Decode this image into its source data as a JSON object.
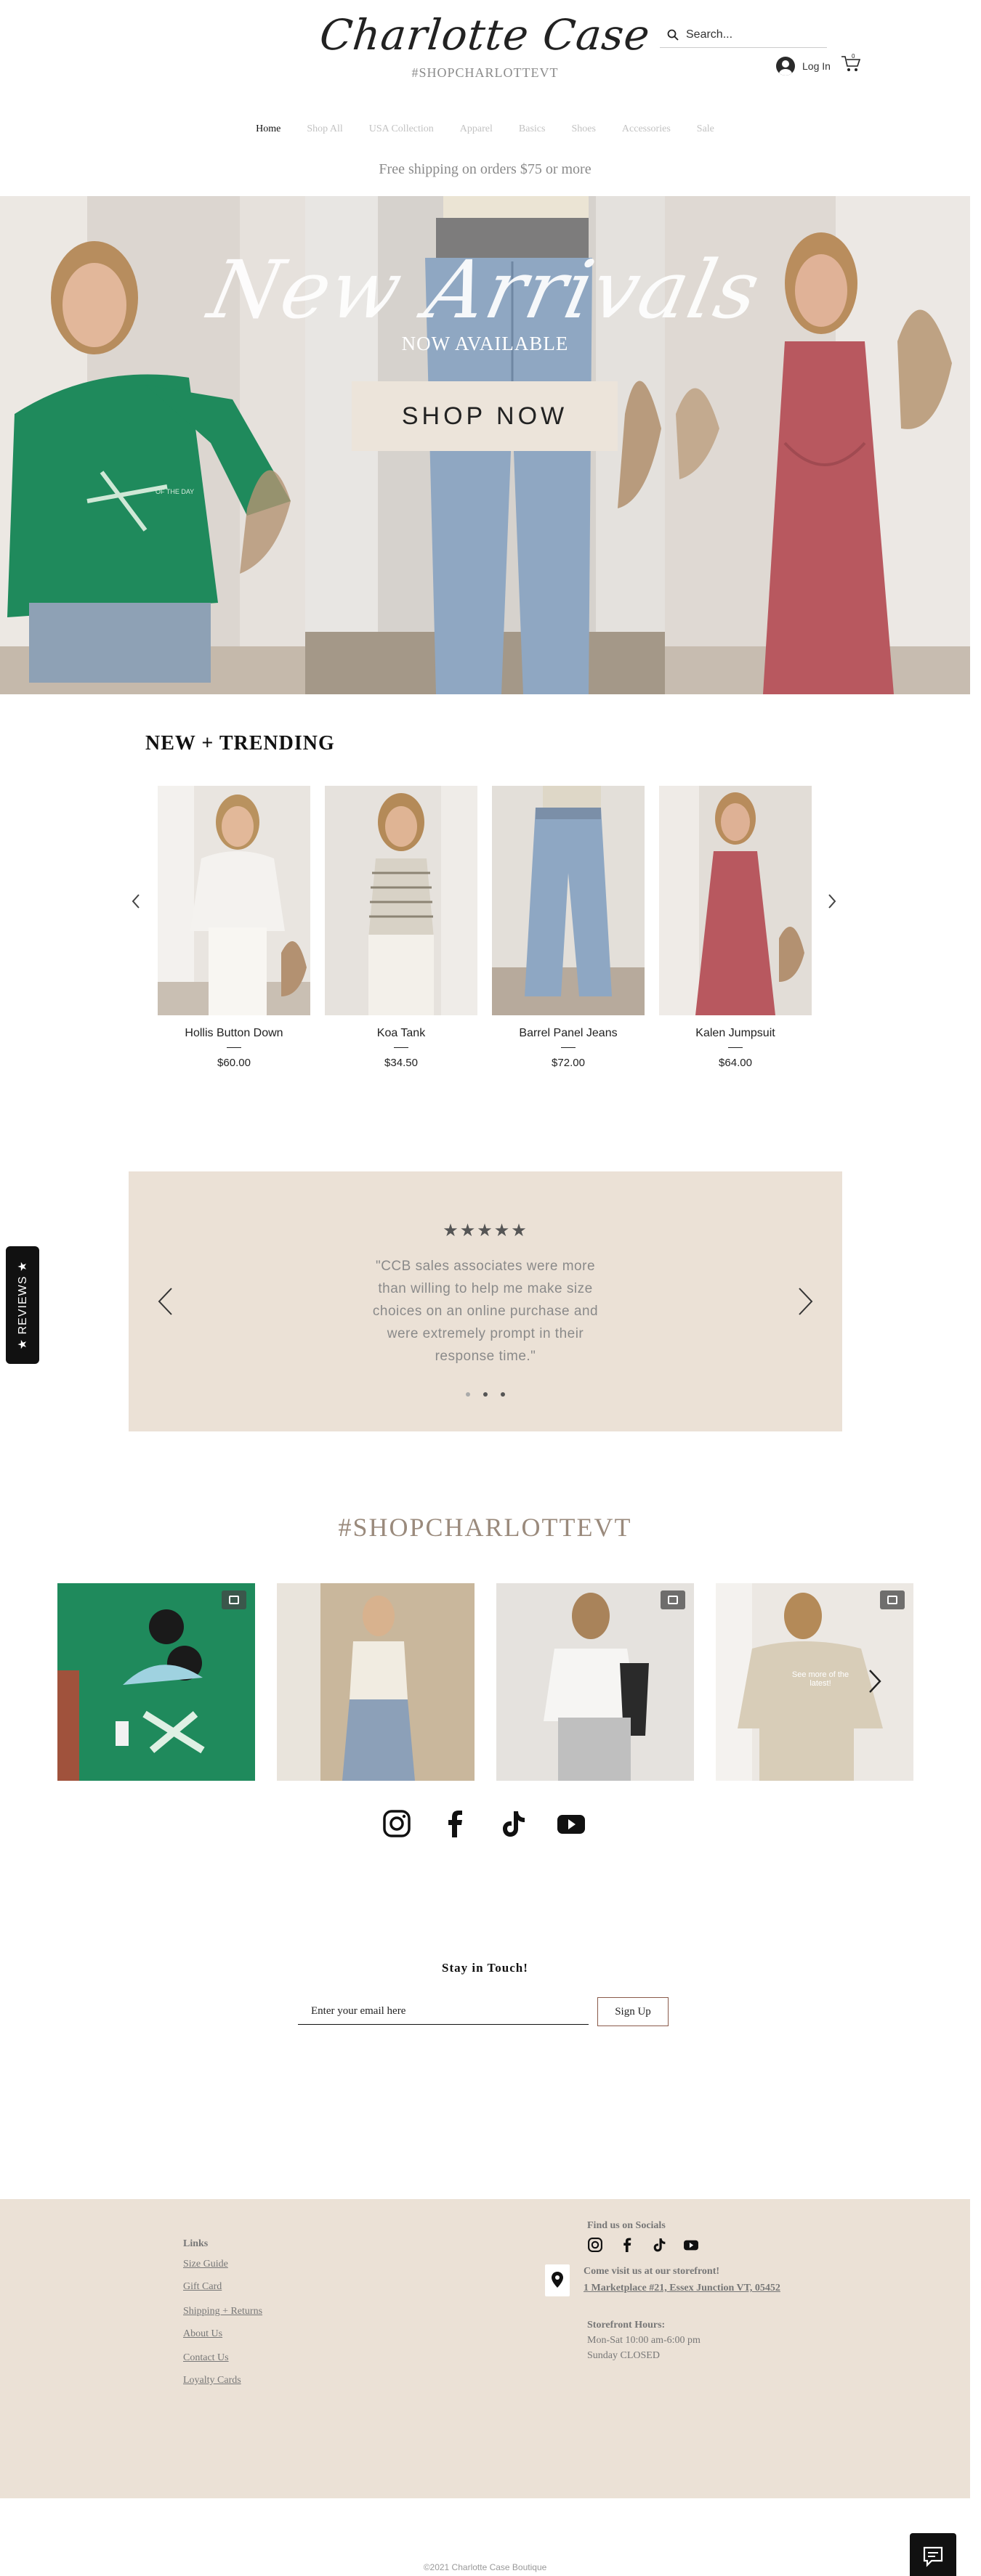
{
  "header": {
    "logo": "Charlotte Case",
    "tagline": "#SHOPCHARLOTTEVT",
    "search_placeholder": "Search...",
    "login_label": "Log In"
  },
  "nav": {
    "items": [
      "Home",
      "Shop All",
      "USA Collection",
      "Apparel",
      "Basics",
      "Shoes",
      "Accessories",
      "Sale"
    ]
  },
  "shipping_banner": "Free shipping on orders $75 or more",
  "hero": {
    "title": "New Arrivals",
    "subtitle": "NOW AVAILABLE",
    "button": "SHOP NOW",
    "shirt_text": "OF THE DAY"
  },
  "trending": {
    "title": "NEW + TRENDING",
    "products": [
      {
        "name": "Hollis Button Down",
        "price": "$60.00"
      },
      {
        "name": "Koa Tank",
        "price": "$34.50"
      },
      {
        "name": "Barrel Panel Jeans",
        "price": "$72.00"
      },
      {
        "name": "Kalen Jumpsuit",
        "price": "$64.00"
      }
    ]
  },
  "reviews": {
    "stars": "★★★★★",
    "quote": "\"CCB sales associates were more than willing to help me make size choices on an online purchase and were extremely prompt in their response time.\"",
    "slide_count": 3,
    "active_slide": 2,
    "side_tab": "★ REVIEWS ★"
  },
  "instagram": {
    "hashtag": "#SHOPCHARLOTTEVT",
    "overlay_text": "See more of the latest!"
  },
  "newsletter": {
    "title": "Stay in Touch!",
    "email_placeholder": "Enter your email here",
    "button": "Sign Up"
  },
  "footer": {
    "links_title": "Links",
    "links": [
      "Size Guide",
      "Gift Card",
      "Shipping + Returns",
      "About Us",
      "Contact Us",
      "Loyalty Cards"
    ],
    "socials_title": "Find us on Socials",
    "visit_title": "Come visit us at our storefront!",
    "address": "1 Marketplace #21, Essex Junction VT, 05452",
    "hours_title": "Storefront Hours:",
    "hours_line1": "Mon-Sat 10:00 am-6:00 pm",
    "hours_line2": "Sunday CLOSED",
    "copyright": "©2021 Charlotte Case Boutique"
  },
  "colors": {
    "beige": "#ebe1d6",
    "button_beige": "#ece4da",
    "hashtag": "#9a8a7c",
    "nav_inactive": "#c2c2c2",
    "green_shirt": "#1f8a5c",
    "rose": "#b8585f"
  }
}
